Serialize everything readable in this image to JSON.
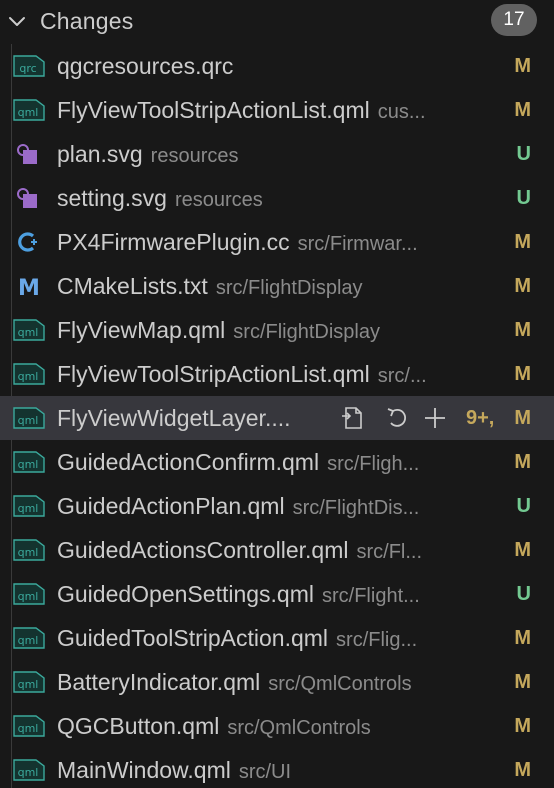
{
  "header": {
    "title": "Changes",
    "count": "17"
  },
  "files": [
    {
      "name": "qgcresources.qrc",
      "path": "",
      "status": "M",
      "icon": "qrc-file-icon",
      "icon_label": "qrc"
    },
    {
      "name": "FlyViewToolStripActionList.qml",
      "path": "cus...",
      "status": "M",
      "icon": "qml-file-icon",
      "icon_label": "qml"
    },
    {
      "name": "plan.svg",
      "path": "resources",
      "status": "U",
      "icon": "svg-file-icon",
      "icon_label": ""
    },
    {
      "name": "setting.svg",
      "path": "resources",
      "status": "U",
      "icon": "svg-file-icon",
      "icon_label": ""
    },
    {
      "name": "PX4FirmwarePlugin.cc",
      "path": "src/Firmwar...",
      "status": "M",
      "icon": "cpp-file-icon",
      "icon_label": ""
    },
    {
      "name": "CMakeLists.txt",
      "path": "src/FlightDisplay",
      "status": "M",
      "icon": "cmake-file-icon",
      "icon_label": "M"
    },
    {
      "name": "FlyViewMap.qml",
      "path": "src/FlightDisplay",
      "status": "M",
      "icon": "qml-file-icon",
      "icon_label": "qml"
    },
    {
      "name": "FlyViewToolStripActionList.qml",
      "path": "src/...",
      "status": "M",
      "icon": "qml-file-icon",
      "icon_label": "qml"
    },
    {
      "name": "FlyViewWidgetLayer....",
      "path": "",
      "status": "M",
      "icon": "qml-file-icon",
      "icon_label": "qml",
      "extra": "9+,"
    },
    {
      "name": "GuidedActionConfirm.qml",
      "path": "src/Fligh...",
      "status": "M",
      "icon": "qml-file-icon",
      "icon_label": "qml"
    },
    {
      "name": "GuidedActionPlan.qml",
      "path": "src/FlightDis...",
      "status": "U",
      "icon": "qml-file-icon",
      "icon_label": "qml"
    },
    {
      "name": "GuidedActionsController.qml",
      "path": "src/Fl...",
      "status": "M",
      "icon": "qml-file-icon",
      "icon_label": "qml"
    },
    {
      "name": "GuidedOpenSettings.qml",
      "path": "src/Flight...",
      "status": "U",
      "icon": "qml-file-icon",
      "icon_label": "qml"
    },
    {
      "name": "GuidedToolStripAction.qml",
      "path": "src/Flig...",
      "status": "M",
      "icon": "qml-file-icon",
      "icon_label": "qml"
    },
    {
      "name": "BatteryIndicator.qml",
      "path": "src/QmlControls",
      "status": "M",
      "icon": "qml-file-icon",
      "icon_label": "qml"
    },
    {
      "name": "QGCButton.qml",
      "path": "src/QmlControls",
      "status": "M",
      "icon": "qml-file-icon",
      "icon_label": "qml"
    },
    {
      "name": "MainWindow.qml",
      "path": "src/UI",
      "status": "M",
      "icon": "qml-file-icon",
      "icon_label": "qml"
    }
  ],
  "selected_index": 8,
  "row_actions": [
    "open-file-icon",
    "discard-changes-icon",
    "stage-changes-icon"
  ],
  "colors": {
    "modified": "#c5a85c",
    "untracked": "#73c991",
    "qml_icon": "#3ba99c",
    "svg_icon": "#9b6bc9",
    "cpp_icon": "#4d9fe0",
    "cmake_icon": "#6aa8e8"
  }
}
